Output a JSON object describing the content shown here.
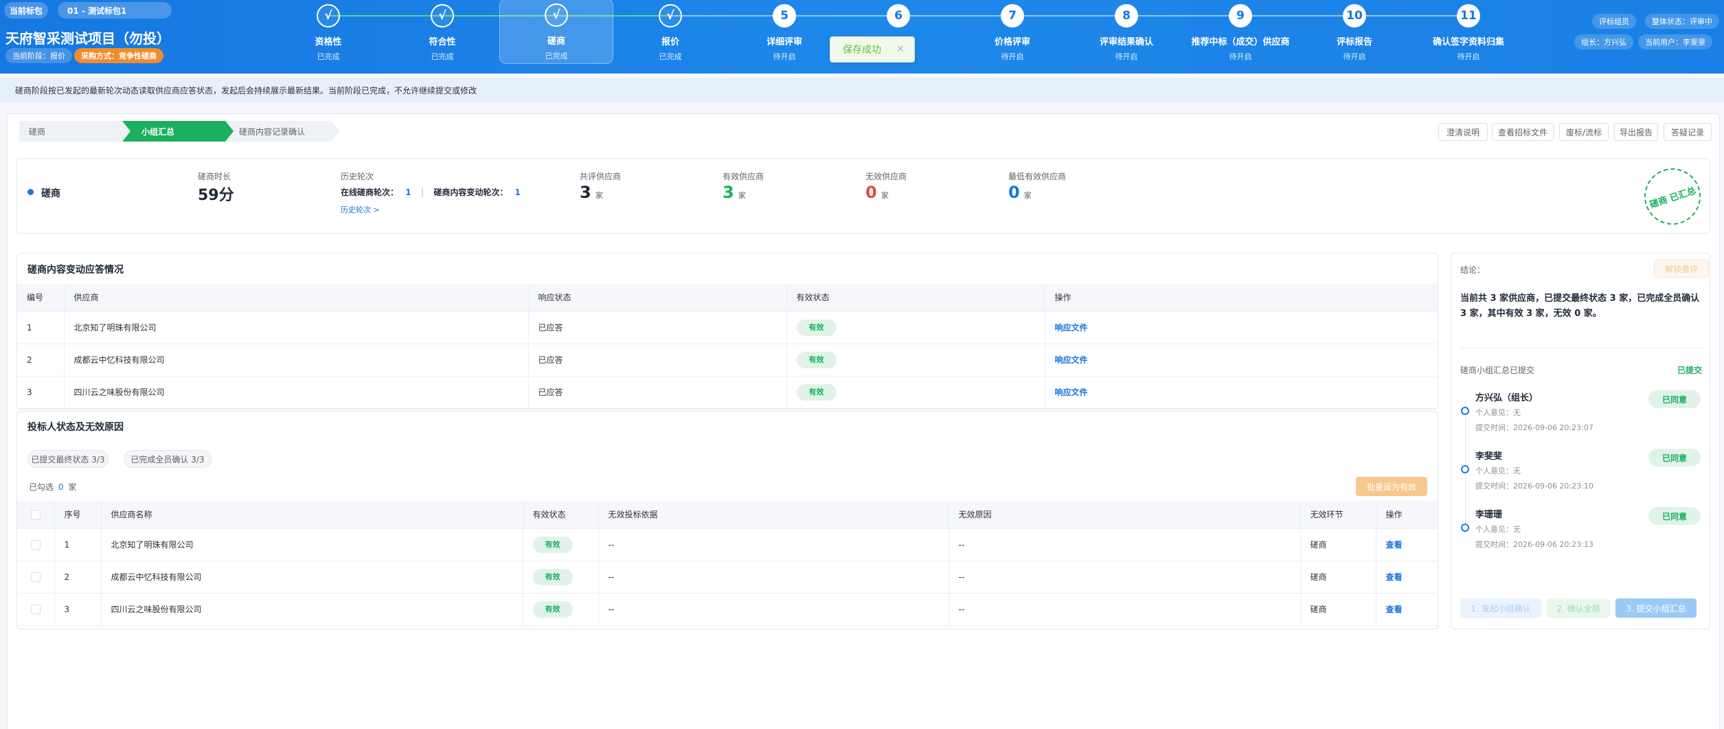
{
  "header": {
    "pill_current_package": "当前标包",
    "pill_package_name": "01 - 测试标包1",
    "project_title": "天府智采测试项目（勿投）",
    "badge_stage": "当前阶段：报价",
    "badge_method": "采购方式：竞争性磋商",
    "right_role": "评标组员",
    "right_overall_status": "整体状态：评审中",
    "right_leader": "组长：方兴弘",
    "right_current_user": "当前用户：李斐斐"
  },
  "steps": [
    {
      "num": "√",
      "label": "资格性",
      "status": "已完成",
      "state": "done"
    },
    {
      "num": "√",
      "label": "符合性",
      "status": "已完成",
      "state": "done"
    },
    {
      "num": "√",
      "label": "磋商",
      "status": "已完成",
      "state": "active"
    },
    {
      "num": "√",
      "label": "报价",
      "status": "已完成",
      "state": "done"
    },
    {
      "num": "5",
      "label": "详细评审",
      "status": "待开启",
      "state": "todo"
    },
    {
      "num": "6",
      "label": "",
      "status": "",
      "state": "todo"
    },
    {
      "num": "7",
      "label": "价格评审",
      "status": "待开启",
      "state": "todo"
    },
    {
      "num": "8",
      "label": "评审结果确认",
      "status": "待开启",
      "state": "todo"
    },
    {
      "num": "9",
      "label": "推荐中标（成交）供应商",
      "status": "待开启",
      "state": "todo"
    },
    {
      "num": "10",
      "label": "评标报告",
      "status": "待开启",
      "state": "todo"
    },
    {
      "num": "11",
      "label": "确认签字资料归集",
      "status": "待开启",
      "state": "todo"
    }
  ],
  "toast": {
    "message": "保存成功",
    "close": "×"
  },
  "notice": "磋商阶段按已发起的最新轮次动态读取供应商应答状态，发起后会持续展示最新结果。当前阶段已完成，不允许继续提交或修改",
  "tabs": [
    "磋商",
    "小组汇总",
    "磋商内容记录确认"
  ],
  "toolbar": [
    "澄清说明",
    "查看招标文件",
    "废标/流标",
    "导出报告",
    "答疑记录"
  ],
  "summary": {
    "stage_name": "磋商",
    "duration_label": "磋商时长",
    "duration_value": "59分",
    "history_label": "历史轮次",
    "online_rounds_label": "在线磋商轮次：",
    "online_rounds_value": "1",
    "sep": "|",
    "change_rounds_label": "磋商内容变动轮次：",
    "change_rounds_value": "1",
    "history_link": "历史轮次 >",
    "total_label": "共评供应商",
    "total_value": "3",
    "valid_label": "有效供应商",
    "valid_value": "3",
    "invalid_label": "无效供应商",
    "invalid_value": "0",
    "min_label": "最低有效供应商",
    "min_value": "0",
    "unit": "家",
    "stamp": "磋商 已汇总"
  },
  "response_table": {
    "title": "磋商内容变动应答情况",
    "headers": [
      "编号",
      "供应商",
      "响应状态",
      "有效状态",
      "操作"
    ],
    "rows": [
      {
        "no": "1",
        "supplier": "北京知了明珠有限公司",
        "status": "已应答",
        "valid": "有效",
        "action": "响应文件"
      },
      {
        "no": "2",
        "supplier": "成都云中忆科技有限公司",
        "status": "已应答",
        "valid": "有效",
        "action": "响应文件"
      },
      {
        "no": "3",
        "supplier": "四川云之味股份有限公司",
        "status": "已应答",
        "valid": "有效",
        "action": "响应文件"
      }
    ]
  },
  "bidder_table": {
    "title": "投标人状态及无效原因",
    "chip1": "已提交最终状态 3/3",
    "chip2": "已完成全员确认 3/3",
    "selected_prefix": "已勾选",
    "selected_count": "0",
    "selected_suffix": "家",
    "batch_button": "批量设为有效",
    "headers": [
      "",
      "序号",
      "供应商名称",
      "有效状态",
      "无效投标依据",
      "无效原因",
      "无效环节",
      "操作"
    ],
    "rows": [
      {
        "no": "1",
        "supplier": "北京知了明珠有限公司",
        "valid": "有效",
        "basis": "--",
        "reason": "--",
        "stage": "磋商",
        "action": "查看"
      },
      {
        "no": "2",
        "supplier": "成都云中忆科技有限公司",
        "valid": "有效",
        "basis": "--",
        "reason": "--",
        "stage": "磋商",
        "action": "查看"
      },
      {
        "no": "3",
        "supplier": "四川云之味股份有限公司",
        "valid": "有效",
        "basis": "--",
        "reason": "--",
        "stage": "磋商",
        "action": "查看"
      }
    ]
  },
  "right_panel": {
    "conclusion_label": "结论：",
    "unlock_button": "解锁重评",
    "conclusion_text": "当前共 3 家供应商，已提交最终状态 3 家，已完成全员确认 3 家，其中有效 3 家，无效 0 家。",
    "submitted_label": "磋商小组汇总已提交",
    "submitted_tag": "已提交",
    "members": [
      {
        "name": "方兴弘（组长）",
        "opinion": "个人意见：无",
        "time": "提交时间：2026-09-06 20:23:07",
        "tag": "已同意"
      },
      {
        "name": "李斐斐",
        "opinion": "个人意见：无",
        "time": "提交时间：2026-09-06 20:23:10",
        "tag": "已同意"
      },
      {
        "name": "李珊珊",
        "opinion": "个人意见：无",
        "time": "提交时间：2026-09-06 20:23:13",
        "tag": "已同意"
      }
    ],
    "btn1": "1. 发起小组确认",
    "btn2": "2. 确认全部",
    "btn3": "3. 提交小组汇总"
  },
  "colors": {
    "primary": "#1677e0",
    "green": "#1ab05c",
    "red": "#e5484d",
    "orange": "#f08c2a"
  }
}
